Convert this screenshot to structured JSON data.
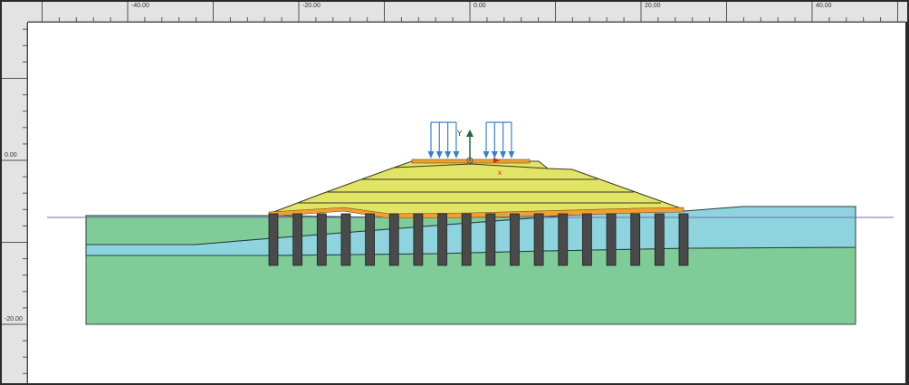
{
  "ruler_top": {
    "labels": [
      {
        "value": -40,
        "text": "-40.00"
      },
      {
        "value": -20,
        "text": "-20.00"
      },
      {
        "value": 0,
        "text": "0.00"
      },
      {
        "value": 20,
        "text": "20.00"
      },
      {
        "value": 40,
        "text": "40.00"
      }
    ]
  },
  "ruler_left": {
    "labels": [
      {
        "value": 0,
        "text": "0.00"
      },
      {
        "value": -20,
        "text": "-20.00"
      }
    ]
  },
  "axes": {
    "y_label": "Y",
    "x_label": "x"
  },
  "model": {
    "pile_count": 18,
    "load_groups": 2,
    "arrows_per_group": 4
  },
  "colors": {
    "soil_green": "#80cc98",
    "soil_cyan": "#8ed4de",
    "embankment": "#e2e466",
    "platform": "#f0a030",
    "pile": "#4a4a4a",
    "load": "#3a80d0",
    "water": "#7070b0",
    "y_axis": "#1f6b3a",
    "x_axis": "#e02020"
  }
}
